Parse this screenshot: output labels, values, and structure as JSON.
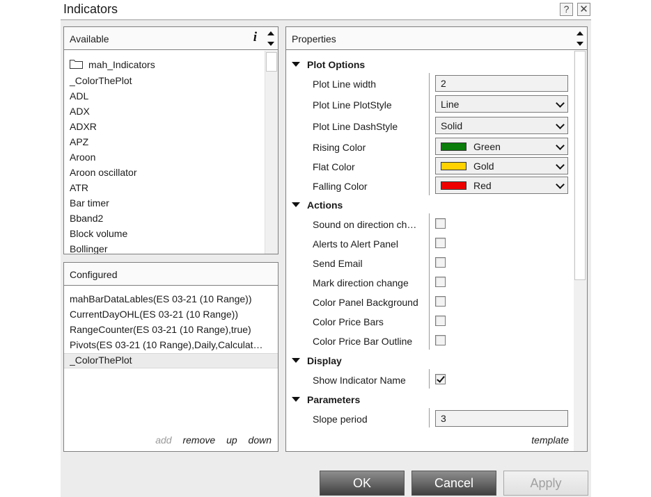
{
  "window": {
    "title": "Indicators",
    "help_label": "?",
    "close_label": "✕"
  },
  "available": {
    "header": "Available",
    "info_label": "i",
    "items": [
      "mah_Indicators",
      "_ColorThePlot",
      "ADL",
      "ADX",
      "ADXR",
      "APZ",
      "Aroon",
      "Aroon oscillator",
      "ATR",
      "Bar timer",
      "Bband2",
      "Block volume",
      "Bollinger"
    ]
  },
  "configured": {
    "header": "Configured",
    "items": [
      "mahBarDataLables(ES 03-21 (10 Range))",
      "CurrentDayOHL(ES 03-21 (10 Range))",
      "RangeCounter(ES 03-21 (10 Range),true)",
      "Pivots(ES 03-21 (10 Range),Daily,Calculat…",
      "_ColorThePlot"
    ],
    "selected_index": 4,
    "actions": {
      "add": "add",
      "remove": "remove",
      "up": "up",
      "down": "down"
    }
  },
  "properties": {
    "header": "Properties",
    "template_label": "template",
    "plot_options": {
      "label": "Plot Options",
      "line_width_label": "Plot Line width",
      "line_width_value": "2",
      "plotstyle_label": "Plot Line PlotStyle",
      "plotstyle_value": "Line",
      "dashstyle_label": "Plot Line DashStyle",
      "dashstyle_value": "Solid",
      "rising_label": "Rising Color",
      "rising_value": "Green",
      "rising_color": "#0a7d0a",
      "flat_label": "Flat Color",
      "flat_value": "Gold",
      "flat_color": "#ffd200",
      "falling_label": "Falling Color",
      "falling_value": "Red",
      "falling_color": "#ee0000"
    },
    "actions": {
      "label": "Actions",
      "sound_label": "Sound on direction ch…",
      "alerts_label": "Alerts to Alert Panel",
      "email_label": "Send Email",
      "mark_label": "Mark direction change",
      "panel_bg_label": "Color Panel Background",
      "price_bars_label": "Color Price Bars",
      "bar_outline_label": "Color Price Bar Outline"
    },
    "display": {
      "label": "Display",
      "show_name_label": "Show Indicator Name",
      "show_name_checked": true
    },
    "parameters": {
      "label": "Parameters",
      "slope_label": "Slope period",
      "slope_value": "3"
    }
  },
  "buttons": {
    "ok": "OK",
    "cancel": "Cancel",
    "apply": "Apply"
  }
}
